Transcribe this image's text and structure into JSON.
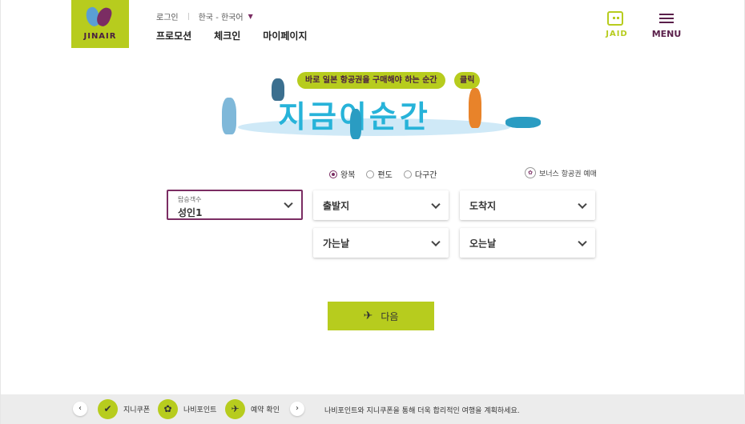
{
  "header": {
    "logo_text": "JINAIR",
    "util": {
      "login": "로그인",
      "language": "한국 - 한국어"
    },
    "nav": [
      "프로모션",
      "체크인",
      "마이페이지"
    ],
    "jaid_label": "JAID",
    "menu_label": "MENU"
  },
  "banner": {
    "bubble": "바로 일본 항공권을 구매해야 하는 순간",
    "click": "클릭",
    "headline": "지금이순간"
  },
  "booking": {
    "trip_types": [
      {
        "label": "왕복",
        "selected": true
      },
      {
        "label": "편도",
        "selected": false
      },
      {
        "label": "다구간",
        "selected": false
      }
    ],
    "bonus_link": "보너스 항공권 예매",
    "passengers": {
      "label": "탑승객수",
      "value": "성인1"
    },
    "origin": "출발지",
    "destination": "도착지",
    "depart_date": "가는날",
    "return_date": "오는날",
    "next_label": "다음"
  },
  "footer": {
    "items": [
      "지니쿠폰",
      "나비포인트",
      "예약 확인"
    ],
    "message": "나비포인트와 지니쿠폰을 통해 더욱 합리적인 여행을 계획하세요."
  },
  "colors": {
    "accent": "#b7cc1e",
    "brand": "#7b2d63",
    "headline": "#27b3d9"
  }
}
